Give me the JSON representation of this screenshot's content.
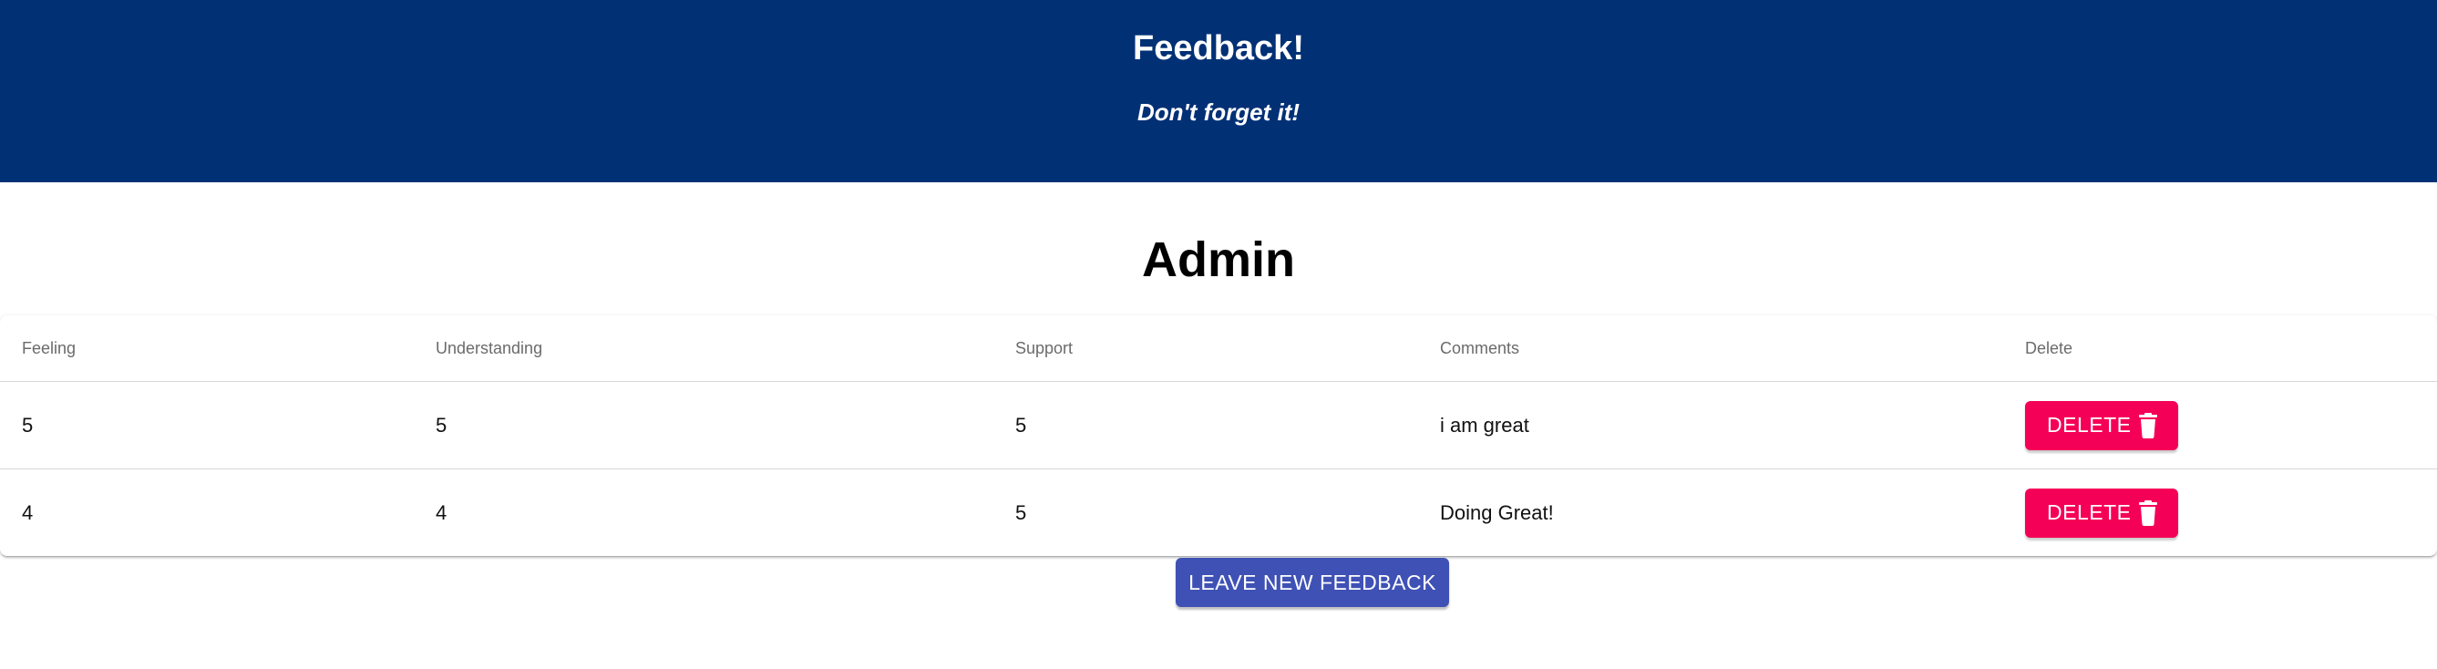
{
  "header": {
    "title": "Feedback!",
    "subtitle": "Don't forget it!"
  },
  "page_title": "Admin",
  "table": {
    "columns": [
      "Feeling",
      "Understanding",
      "Support",
      "Comments",
      "Delete"
    ],
    "rows": [
      {
        "feeling": "5",
        "understanding": "5",
        "support": "5",
        "comments": "i am great",
        "delete_label": "DELETE"
      },
      {
        "feeling": "4",
        "understanding": "4",
        "support": "5",
        "comments": "Doing Great!",
        "delete_label": "DELETE"
      }
    ]
  },
  "leave_feedback_label": "LEAVE NEW FEEDBACK",
  "icons": {
    "delete": "trash-icon"
  },
  "colors": {
    "header_bg": "#023075",
    "delete_button": "#f50057",
    "primary_button": "#3f51b5"
  }
}
